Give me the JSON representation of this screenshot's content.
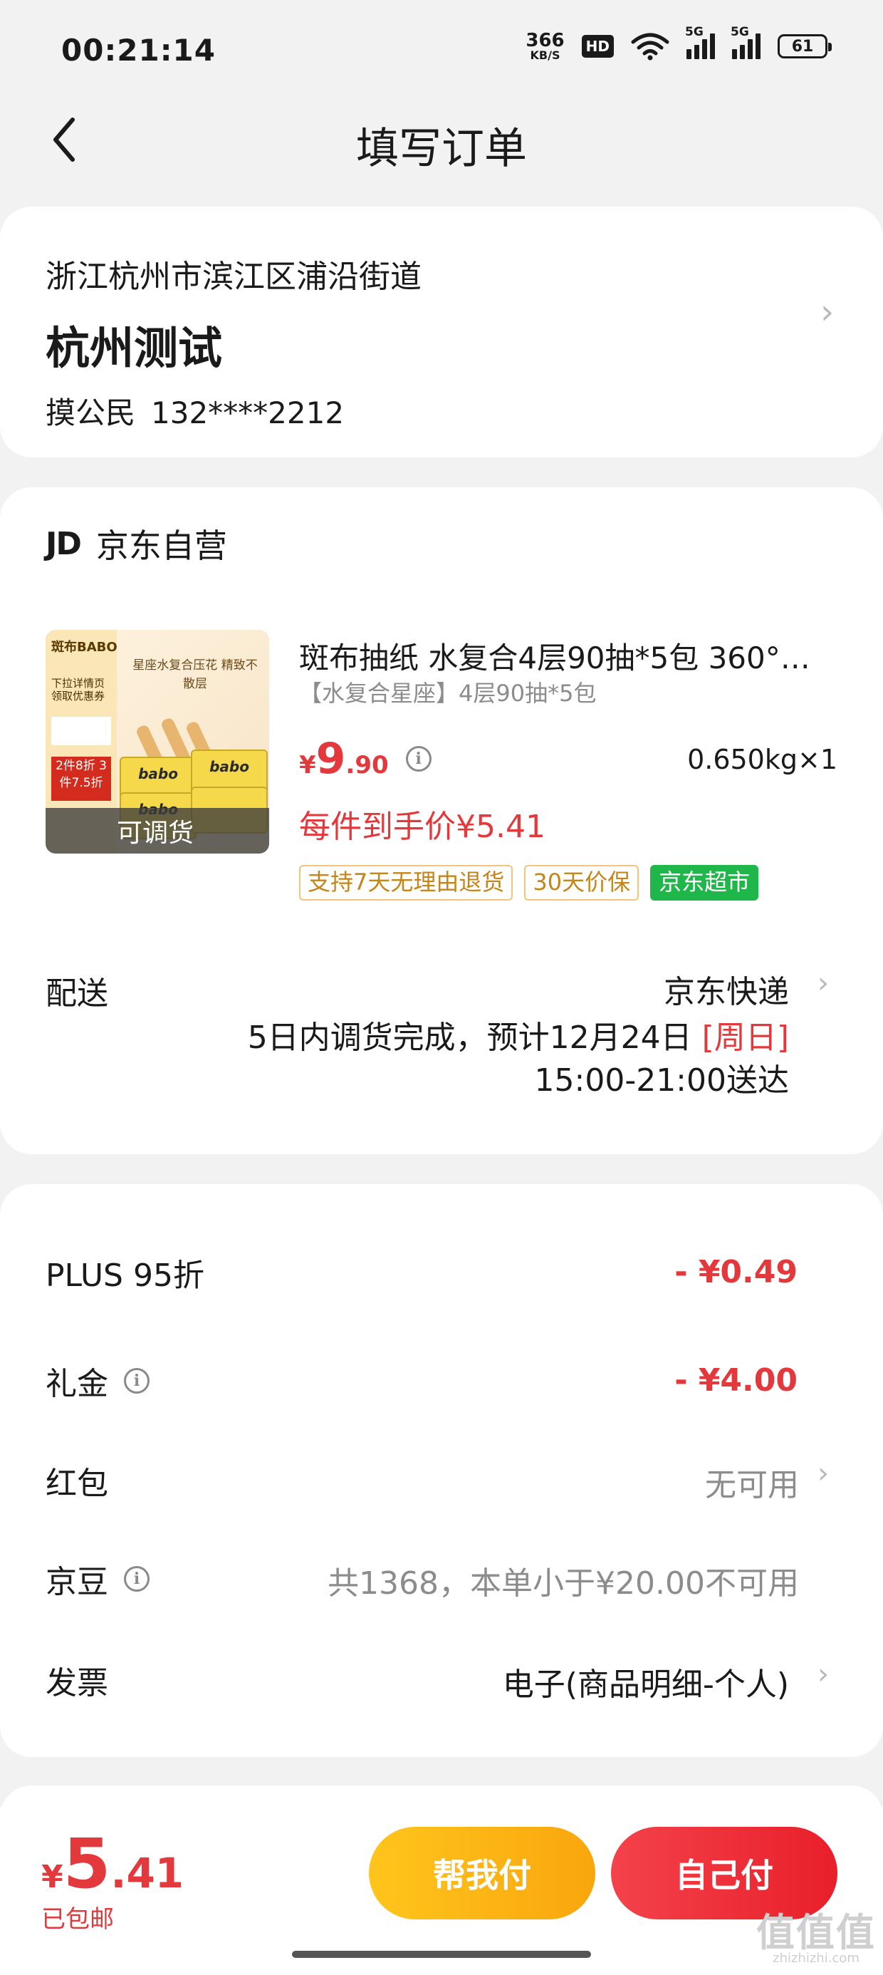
{
  "status_bar": {
    "time": "00:21:14",
    "net_speed_value": "366",
    "net_speed_unit": "KB/S",
    "hd_label": "HD",
    "sim1": "5G",
    "sim2": "5G",
    "battery": "61"
  },
  "header": {
    "title": "填写订单"
  },
  "address": {
    "region": "浙江杭州市滨江区浦沿街道",
    "detail": "杭州测试",
    "name": "摸公民",
    "phone": "132****2212"
  },
  "shop": {
    "logo": "JD",
    "name": "京东自营"
  },
  "product": {
    "image": {
      "brand": "斑布BABO",
      "promo1": "下拉详情页领取优惠券",
      "promo2": "2件8折 3件7.5折",
      "headline": "星座水复合压花 精致不散层",
      "box_label": "babo",
      "overlay": "可调货"
    },
    "title": "斑布抽纸 水复合4层90抽*5包 360°…",
    "spec": "【水复合星座】4层90抽*5包",
    "price_currency": "¥",
    "price_int": "9",
    "price_dec": ".90",
    "weight_qty": "0.650kg×1",
    "net_price": "每件到手价¥5.41",
    "badges": [
      "支持7天无理由退货",
      "30天价保",
      "京东超市"
    ]
  },
  "shipping": {
    "label": "配送",
    "method": "京东快递",
    "line2_prefix": "5日内调货完成，预计12月24日 ",
    "line2_weekday": "[周日]",
    "line3": "15:00-21:00送达"
  },
  "discounts": {
    "plus_label": "PLUS 95折",
    "plus_value": "- ¥0.49",
    "gift_label": "礼金",
    "gift_value": "- ¥4.00",
    "redpacket_label": "红包",
    "redpacket_value": "无可用",
    "beans_label": "京豆",
    "beans_value": "共1368，本单小于¥20.00不可用",
    "invoice_label": "发票",
    "invoice_value": "电子(商品明细-个人)"
  },
  "bottom": {
    "total_currency": "¥",
    "total_int": "5",
    "total_dec": ".41",
    "free_shipping": "已包邮",
    "help_pay": "帮我付",
    "self_pay": "自己付"
  },
  "watermark": {
    "mark": "值值值",
    "site": "zhizhizhi.com"
  },
  "colors": {
    "accent_red": "#e4393c",
    "yellow_button": "#ffc51c",
    "red_button": "#f4424b",
    "green_badge": "#20b74a",
    "background": "#f2f2f2"
  }
}
